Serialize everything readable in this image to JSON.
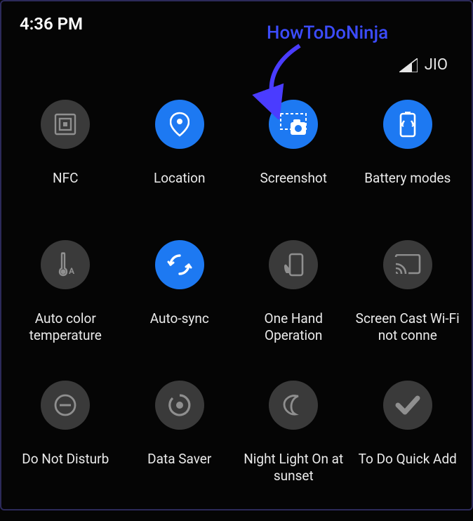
{
  "status_bar": {
    "time": "4:36 PM"
  },
  "signal": {
    "carrier": "JIO"
  },
  "watermark": {
    "text": "HowToDoNinja"
  },
  "tiles": {
    "nfc": {
      "label": "NFC"
    },
    "location": {
      "label": "Location"
    },
    "screenshot": {
      "label": "Screenshot"
    },
    "battery_modes": {
      "label": "Battery modes"
    },
    "auto_color_temp": {
      "label": "Auto color temperature"
    },
    "auto_sync": {
      "label": "Auto-sync"
    },
    "one_hand": {
      "label": "One Hand Operation"
    },
    "screen_cast": {
      "label": "Screen Cast Wi-Fi not conne"
    },
    "dnd": {
      "label": "Do Not Disturb"
    },
    "data_saver": {
      "label": "Data Saver"
    },
    "night_light": {
      "label": "Night Light On at sunset"
    },
    "todo_quick_add": {
      "label": "To Do Quick Add"
    }
  }
}
